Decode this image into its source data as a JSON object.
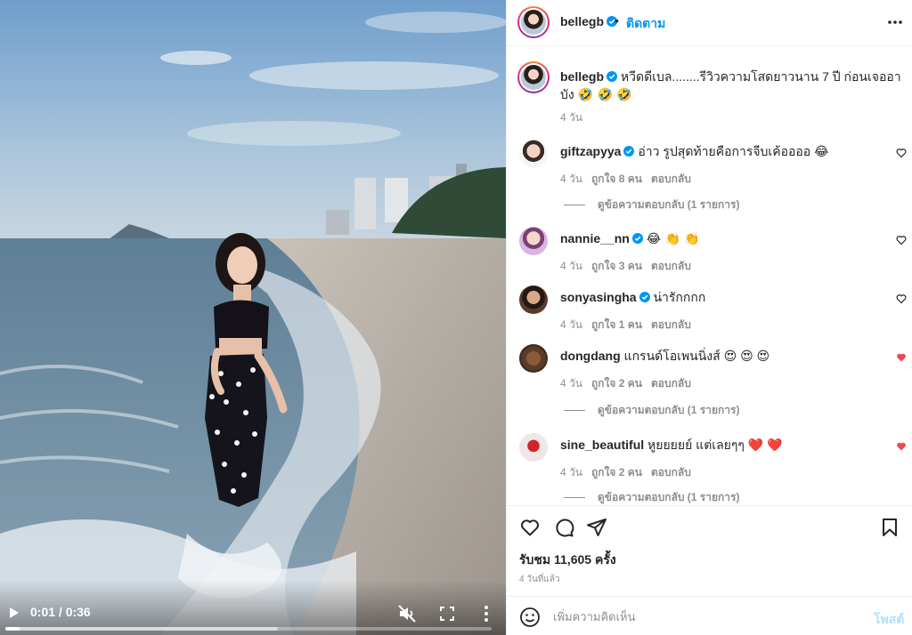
{
  "video": {
    "time_display": "0:01 / 0:36",
    "progress_fraction": 0.03,
    "buffered_fraction": 0.56
  },
  "header": {
    "username": "bellegb",
    "separator": "•",
    "follow_label": "ติดตาม"
  },
  "caption": {
    "username": "bellegb",
    "text": "หวีดดีเบล........รีวิวความโสดยาวนาน 7 ปี ก่อนเจออาบัง",
    "emoji": "🤣 🤣 🤣",
    "time": "4 วัน"
  },
  "comments": [
    {
      "username": "giftzapyya",
      "verified": true,
      "text": "อ่าว รูปสุดท้ายคือการจีบเค้ออออ 😂",
      "time": "4 วัน",
      "likes": "ถูกใจ 8 คน",
      "reply": "ตอบกลับ",
      "liked": false,
      "view_replies": "ดูข้อความตอบกลับ (1 รายการ)"
    },
    {
      "username": "nannie__nn",
      "verified": true,
      "text": "😂 👏 👏",
      "time": "4 วัน",
      "likes": "ถูกใจ 3 คน",
      "reply": "ตอบกลับ",
      "liked": false,
      "view_replies": ""
    },
    {
      "username": "sonyasingha",
      "verified": true,
      "text": "น่ารักกกก",
      "time": "4 วัน",
      "likes": "ถูกใจ 1 คน",
      "reply": "ตอบกลับ",
      "liked": false,
      "view_replies": ""
    },
    {
      "username": "dongdang",
      "verified": false,
      "text": "แกรนด์โอเพนนิ่งส์ 😍 😍 😍",
      "time": "4 วัน",
      "likes": "ถูกใจ 2 คน",
      "reply": "ตอบกลับ",
      "liked": true,
      "view_replies": "ดูข้อความตอบกลับ (1 รายการ)"
    },
    {
      "username": "sine_beautiful",
      "verified": false,
      "text": "หูยยยยย์ แต่เลยๆๆ ❤️ ❤️",
      "time": "4 วัน",
      "likes": "ถูกใจ 2 คน",
      "reply": "ตอบกลับ",
      "liked": true,
      "view_replies": "ดูข้อความตอบกลับ (1 รายการ)"
    }
  ],
  "stats": {
    "views": "รับชม 11,605 ครั้ง",
    "posted": "4 วันที่แล้ว"
  },
  "composer": {
    "placeholder": "เพิ่มความคิดเห็น",
    "post_label": "โพสต์"
  },
  "colors": {
    "accent": "#0095f6",
    "like_red": "#ed4956",
    "muted": "#8e8e8e",
    "text": "#262626",
    "post_disabled": "#b2dffc"
  },
  "icons": {
    "video": [
      "play-icon",
      "mute-icon",
      "fullscreen-icon",
      "more-vertical-icon"
    ],
    "actions": [
      "heart-icon",
      "comment-icon",
      "share-icon",
      "bookmark-icon"
    ],
    "other": [
      "verified-badge-icon",
      "more-horizontal-icon",
      "emoji-icon"
    ]
  }
}
